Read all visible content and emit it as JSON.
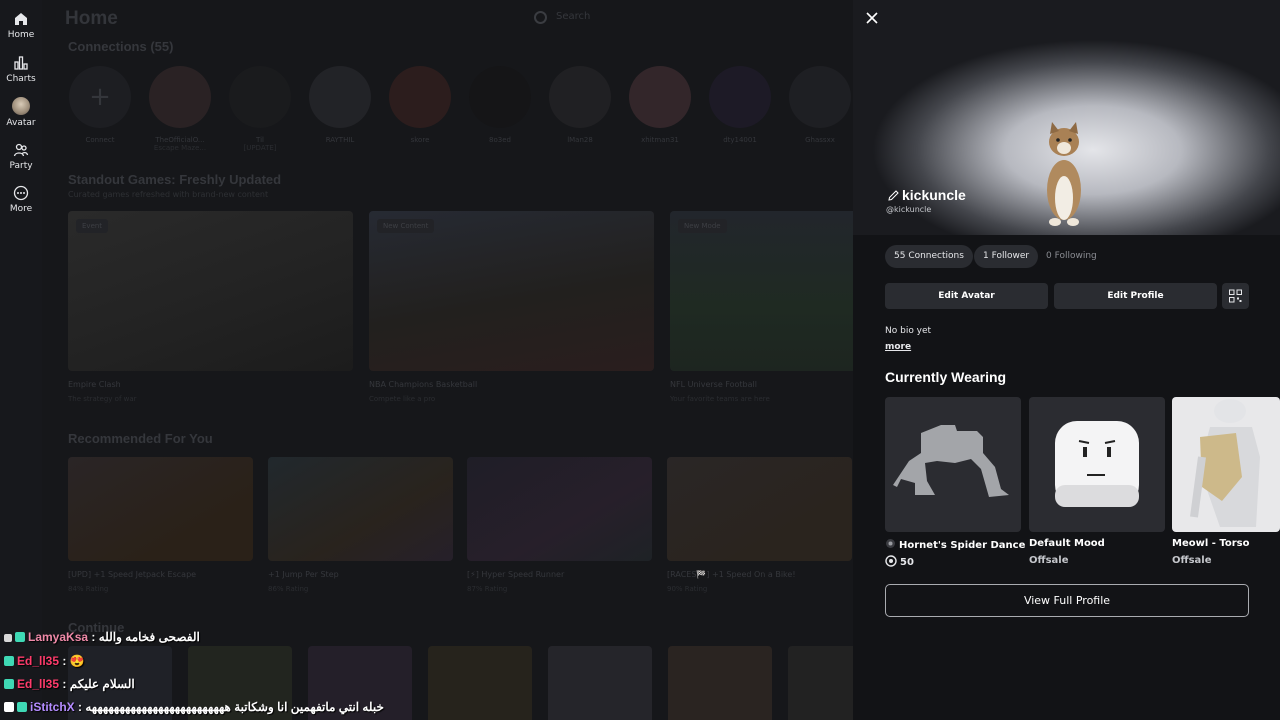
{
  "sidebar": {
    "items": [
      {
        "label": "Home",
        "icon": "home-icon"
      },
      {
        "label": "Charts",
        "icon": "chart-icon"
      },
      {
        "label": "Avatar",
        "icon": "avatar-icon"
      },
      {
        "label": "Party",
        "icon": "party-icon"
      },
      {
        "label": "More",
        "icon": "more-icon"
      }
    ]
  },
  "home": {
    "title": "Home",
    "search_placeholder": "Search",
    "connections_title": "Connections (55)",
    "connections": [
      {
        "name": "Connect",
        "sub": ""
      },
      {
        "name": "TheOfficialO...",
        "sub": "Escape Maze..."
      },
      {
        "name": "Til",
        "sub": "[UPDATE]"
      },
      {
        "name": "RAYTHIL",
        "sub": ""
      },
      {
        "name": "skore",
        "sub": ""
      },
      {
        "name": "8o3ed",
        "sub": ""
      },
      {
        "name": "lMan28",
        "sub": ""
      },
      {
        "name": "xhitman31",
        "sub": ""
      },
      {
        "name": "dty14001",
        "sub": ""
      },
      {
        "name": "Ghassxx",
        "sub": ""
      }
    ],
    "standout_title": "Standout Games: Freshly Updated",
    "standout_sub": "Curated games refreshed with brand-new content",
    "standout_games": [
      {
        "badge": "Event",
        "name": "Empire Clash",
        "desc": "The strategy of war"
      },
      {
        "badge": "New Content",
        "name": "NBA Champions Basketball",
        "desc": "Compete like a pro"
      },
      {
        "badge": "New Mode",
        "name": "NFL Universe Football",
        "desc": "Your favorite teams are here"
      }
    ],
    "recommended_title": "Recommended For You",
    "recommended": [
      {
        "name": "[UPD] +1 Speed Jetpack Escape",
        "rating": "84% Rating"
      },
      {
        "name": "+1 Jump Per Step",
        "rating": "86% Rating"
      },
      {
        "name": "[⚡] Hyper Speed Runner",
        "rating": "87% Rating"
      },
      {
        "name": "[RACES🏁] +1 Speed On a Bike!",
        "rating": "90% Rating"
      }
    ],
    "continue_title": "Continue"
  },
  "chat": [
    {
      "user": "LamyaKsa",
      "text": ": الفصحى فخامه والله",
      "color": "#f08aa9"
    },
    {
      "user": "Ed_ll35",
      "text": ": 😍",
      "color": "#ff3b6b"
    },
    {
      "user": "Ed_ll35",
      "text": ": السلام عليكم",
      "color": "#ff3b6b"
    },
    {
      "user": "iStitchX",
      "text": ": خبله انتي ماتفهمين انا وشكاتبة هههههههههههههههههههههههههه",
      "color": "#b48cff"
    }
  ],
  "profile": {
    "close_icon": "close-icon",
    "username": "kickuncle",
    "handle": "@kickuncle",
    "connections": "55 Connections",
    "followers": "1 Follower",
    "following": "0 Following",
    "edit_avatar": "Edit Avatar",
    "edit_profile": "Edit Profile",
    "bio": "No bio yet",
    "more": "more",
    "wearing_title": "Currently Wearing",
    "items": [
      {
        "name": "Hornet's Spider Dance",
        "price": "50",
        "icon": "robux-icon"
      },
      {
        "name": "Default Mood",
        "price": "Offsale"
      },
      {
        "name": "Meowl - Torso",
        "price": "Offsale"
      }
    ],
    "view_full": "View Full Profile"
  }
}
